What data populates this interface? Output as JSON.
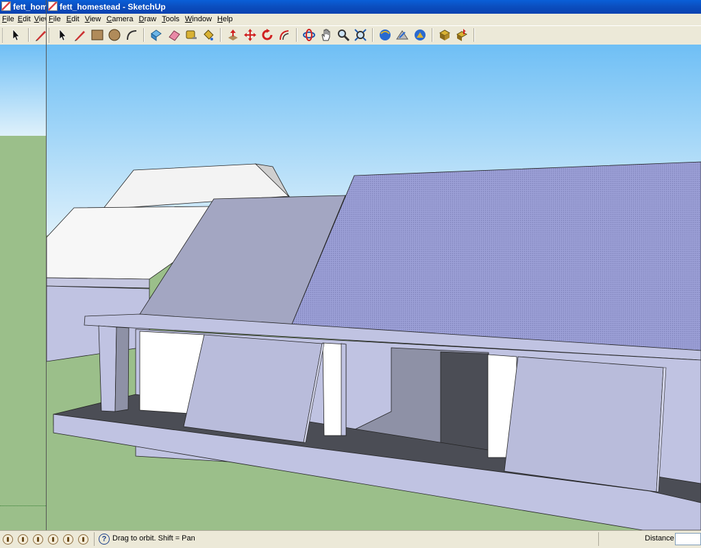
{
  "back_window": {
    "title": "fett_homestead - SketchUp",
    "menu": [
      "File",
      "Edit",
      "View"
    ]
  },
  "window": {
    "title": "fett_homestead - SketchUp",
    "menu": [
      "File",
      "Edit",
      "View",
      "Camera",
      "Draw",
      "Tools",
      "Window",
      "Help"
    ]
  },
  "toolbar": {
    "tools": [
      "select-tool",
      "line-tool",
      "rectangle-tool",
      "circle-tool",
      "arc-tool",
      "make-component-tool",
      "eraser-tool",
      "tape-measure-tool",
      "paint-bucket-tool",
      "push-pull-tool",
      "move-tool",
      "rotate-tool",
      "offset-tool",
      "orbit-tool",
      "pan-tool",
      "zoom-tool",
      "zoom-extents-tool",
      "previous-view-tool",
      "next-view-tool",
      "standard-views-tool",
      "get-models-tool",
      "share-model-tool"
    ]
  },
  "statusbar": {
    "hint": "Drag to orbit.  Shift = Pan",
    "measurements_label": "Distance",
    "measurements_value": ""
  },
  "colors": {
    "sky_top": "#6fbff5",
    "sky_bottom": "#dff1fb",
    "ground": "#9bbf8a",
    "roof_front": "#9b9fd6",
    "roof_side": "#a3a6c2",
    "wall": "#c0c3e2",
    "deck_shadow": "#4b4d55",
    "titlebar": "#0b4fc0"
  }
}
